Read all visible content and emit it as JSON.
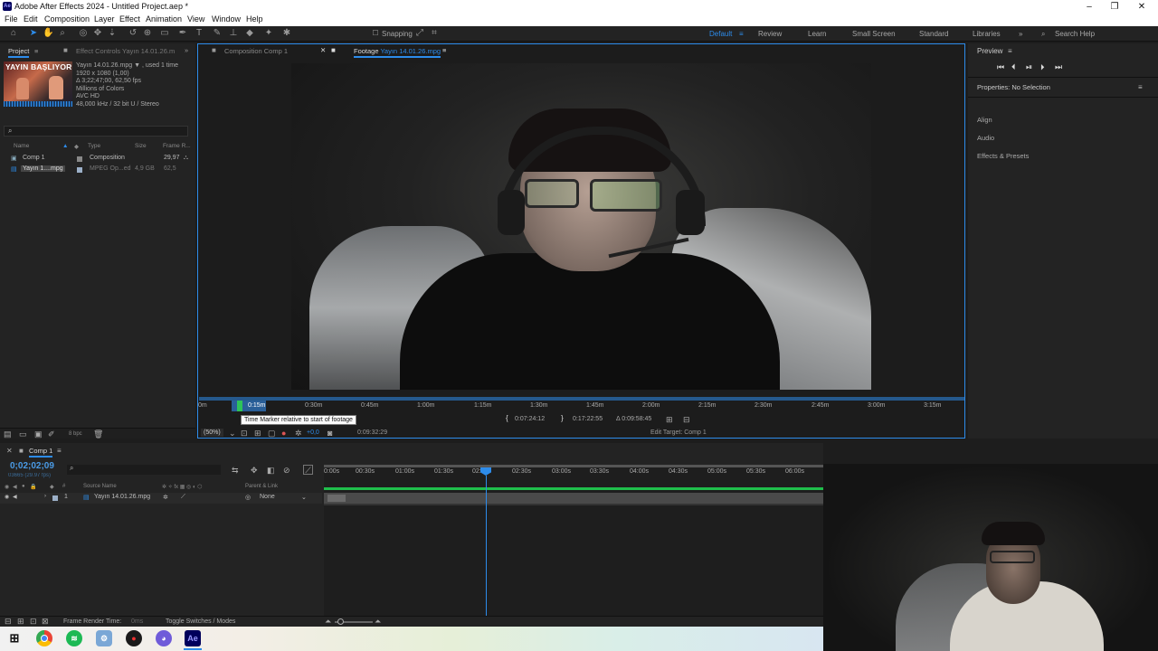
{
  "titlebar": {
    "title": "Adobe After Effects 2024 - Untitled Project.aep *",
    "app_badge": "Ae",
    "minimize": "–",
    "maximize": "❐",
    "close": "✕"
  },
  "menu": [
    "File",
    "Edit",
    "Composition",
    "Layer",
    "Effect",
    "Animation",
    "View",
    "Window",
    "Help"
  ],
  "toolbar": {
    "snapping": "Snapping",
    "workspaces": [
      "Default",
      "Review",
      "Learn",
      "Small Screen",
      "Standard",
      "Libraries"
    ],
    "search_help": "Search Help"
  },
  "project": {
    "tab": "Project",
    "effect_controls_tab": "Effect Controls Yayın 14.01.26.m",
    "thumb_text": "YAYIN BAŞLIYOR",
    "info": [
      "Yayın 14.01.26.mpg ▼ , used 1 time",
      "1920 x 1080 (1,00)",
      "Δ 3;22;47;00, 62,50 fps",
      "Millions of Colors",
      "AVC HD",
      "48,000 kHz / 32 bit U / Stereo"
    ],
    "columns": [
      "Name",
      "Type",
      "Size",
      "Frame R..."
    ],
    "rows": [
      {
        "name": "Comp 1",
        "type": "Composition",
        "size": "",
        "fr": "29,97"
      },
      {
        "name": "Yayın 1....mpg",
        "type": "MPEG Op...ed",
        "size": "4,9 GB",
        "fr": "62,5"
      }
    ],
    "bpc": "8 bpc"
  },
  "viewer": {
    "tab_comp": "Composition Comp 1",
    "tab_footage_prefix": "Footage",
    "tab_footage_name": "Yayın 14.01.26.mpg",
    "ruler": [
      "0m",
      "0:15m",
      "0:30m",
      "0:45m",
      "1:00m",
      "1:15m",
      "1:30m",
      "1:45m",
      "2:00m",
      "2:15m",
      "2:30m",
      "2:45m",
      "3:00m",
      "3:15m"
    ],
    "tooltip": "Time Marker relative to start of footage",
    "in_point": "0:07:24:12",
    "out_point": "0:17:22:55",
    "duration": "Δ 0:09:58:45",
    "zoom": "(50%)",
    "offset": "+0,0",
    "timecode": "0:09:32:29",
    "edit_target": "Edit Target: Comp 1"
  },
  "right_panel": {
    "preview": "Preview",
    "properties": "Properties: No Selection",
    "items": [
      "Align",
      "Audio",
      "Effects & Presets"
    ]
  },
  "timeline": {
    "tab": "Comp 1",
    "timecode": "0;02;02;09",
    "frame_info": "03665 (29.97 fps)",
    "columns": {
      "source": "Source Name",
      "parent": "Parent & Link"
    },
    "ticks": [
      "0:00s",
      "00:30s",
      "01:00s",
      "01:30s",
      "02:00s",
      "02:30s",
      "03:00s",
      "03:30s",
      "04:00s",
      "04:30s",
      "05:00s",
      "05:30s",
      "06:00s"
    ],
    "layer": {
      "index": "1",
      "name": "Yayın 14.01.26.mpg",
      "parent": "None"
    },
    "footer_render": "Frame Render Time:",
    "footer_render_val": "0ms",
    "footer_toggle": "Toggle Switches / Modes"
  },
  "colors": {
    "accent": "#2d8ceb",
    "layer_bar": "#1fbe4b",
    "timecode": "#4a9be6"
  }
}
